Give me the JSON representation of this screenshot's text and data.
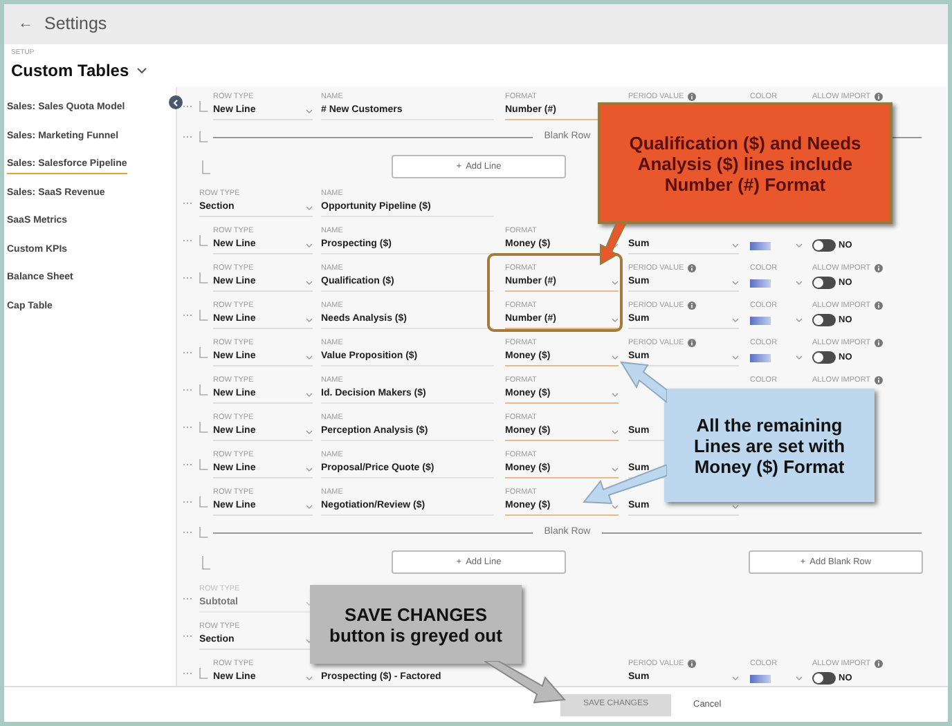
{
  "header": {
    "back": "←",
    "title": "Settings"
  },
  "setup": {
    "label": "SETUP",
    "title": "Custom Tables"
  },
  "sidebar": {
    "items": [
      {
        "label": "Sales: Sales Quota Model",
        "selected": false
      },
      {
        "label": "Sales: Marketing Funnel",
        "selected": false
      },
      {
        "label": "Sales: Salesforce Pipeline",
        "selected": true
      },
      {
        "label": "Sales: SaaS Revenue",
        "selected": false
      },
      {
        "label": "SaaS Metrics",
        "selected": false
      },
      {
        "label": "Custom KPIs",
        "selected": false
      },
      {
        "label": "Balance Sheet",
        "selected": false
      },
      {
        "label": "Cap Table",
        "selected": false
      }
    ]
  },
  "rows": [
    {
      "kind": "line",
      "row_type": {
        "label": "ROW TYPE",
        "value": "New Line"
      },
      "name": {
        "label": "NAME",
        "value": "# New Customers"
      },
      "format": {
        "label": "FORMAT",
        "value": "Number (#)"
      },
      "period_value": {
        "label": "PERIOD VALUE"
      },
      "color": {
        "label": "COLOR"
      },
      "allow_import": {
        "label": "ALLOW IMPORT"
      }
    },
    {
      "kind": "blank",
      "text": "Blank Row"
    },
    {
      "kind": "add",
      "buttons": [
        {
          "label": "Add Line",
          "icon": "+"
        }
      ]
    },
    {
      "kind": "section",
      "row_type": {
        "label": "ROW TYPE",
        "value": "Section"
      },
      "name": {
        "label": "NAME",
        "value": "Opportunity Pipeline ($)"
      }
    },
    {
      "kind": "line",
      "row_type": {
        "label": "ROW TYPE",
        "value": "New Line"
      },
      "name": {
        "label": "NAME",
        "value": "Prospecting ($)"
      },
      "format": {
        "label": "FORMAT",
        "value": "Money ($)"
      },
      "period_value": {
        "value": "Sum"
      },
      "color": {
        "swatch": true
      },
      "allow_import": {
        "on": false,
        "value": "NO"
      }
    },
    {
      "kind": "line",
      "row_type": {
        "label": "ROW TYPE",
        "value": "New Line"
      },
      "name": {
        "label": "NAME",
        "value": "Qualification ($)"
      },
      "format": {
        "label": "FORMAT",
        "value": "Number (#)"
      },
      "period_value": {
        "label": "PERIOD VALUE",
        "value": "Sum"
      },
      "color": {
        "label": "COLOR",
        "swatch": true
      },
      "allow_import": {
        "label": "ALLOW IMPORT",
        "on": false,
        "value": "NO"
      }
    },
    {
      "kind": "line",
      "row_type": {
        "label": "ROW TYPE",
        "value": "New Line"
      },
      "name": {
        "label": "NAME",
        "value": "Needs Analysis ($)"
      },
      "format": {
        "label": "FORMAT",
        "value": "Number (#)"
      },
      "period_value": {
        "label": "PERIOD VALUE",
        "value": "Sum"
      },
      "color": {
        "label": "COLOR",
        "swatch": true
      },
      "allow_import": {
        "label": "ALLOW IMPORT",
        "on": false,
        "value": "NO"
      }
    },
    {
      "kind": "line",
      "row_type": {
        "label": "ROW TYPE",
        "value": "New Line"
      },
      "name": {
        "label": "NAME",
        "value": "Value Proposition ($)"
      },
      "format": {
        "label": "FORMAT",
        "value": "Money ($)"
      },
      "period_value": {
        "label": "PERIOD VALUE",
        "value": "Sum"
      },
      "color": {
        "label": "COLOR",
        "swatch": true
      },
      "allow_import": {
        "label": "ALLOW IMPORT",
        "on": false,
        "value": "NO"
      }
    },
    {
      "kind": "line",
      "row_type": {
        "label": "ROW TYPE",
        "value": "New Line"
      },
      "name": {
        "label": "NAME",
        "value": "Id. Decision Makers ($)"
      },
      "format": {
        "label": "FORMAT",
        "value": "Money ($)"
      },
      "color": {
        "label": "COLOR"
      },
      "allow_import": {
        "label": "ALLOW IMPORT"
      }
    },
    {
      "kind": "line",
      "row_type": {
        "label": "ROW TYPE",
        "value": "New Line"
      },
      "name": {
        "label": "NAME",
        "value": "Perception Analysis ($)"
      },
      "format": {
        "label": "FORMAT",
        "value": "Money ($)"
      },
      "period_value": {
        "value": "Sum"
      }
    },
    {
      "kind": "line",
      "row_type": {
        "label": "ROW TYPE",
        "value": "New Line"
      },
      "name": {
        "label": "NAME",
        "value": "Proposal/Price Quote ($)"
      },
      "format": {
        "label": "FORMAT",
        "value": "Money ($)"
      },
      "period_value": {
        "value": "Sum"
      }
    },
    {
      "kind": "line",
      "row_type": {
        "label": "ROW TYPE",
        "value": "New Line"
      },
      "name": {
        "label": "NAME",
        "value": "Negotiation/Review ($)"
      },
      "format": {
        "label": "FORMAT",
        "value": "Money ($)"
      },
      "period_value": {
        "value": "Sum"
      }
    },
    {
      "kind": "blank",
      "text": "Blank Row"
    },
    {
      "kind": "add",
      "buttons": [
        {
          "label": "Add Line",
          "icon": "+"
        },
        {
          "label": "Add Blank Row",
          "icon": "+"
        }
      ]
    },
    {
      "kind": "subtotal",
      "disabled": true,
      "row_type": {
        "label": "ROW TYPE",
        "value": "Subtotal"
      }
    },
    {
      "kind": "section",
      "disabled": false,
      "row_type": {
        "label": "ROW TYPE",
        "value": "Section"
      }
    },
    {
      "kind": "line",
      "row_type": {
        "label": "ROW TYPE",
        "value": "New Line"
      },
      "name": {
        "value": "Prospecting ($) - Factored"
      },
      "period_value": {
        "label": "PERIOD VALUE",
        "value": "Sum"
      },
      "color": {
        "label": "COLOR",
        "swatch": true
      },
      "allow_import": {
        "label": "ALLOW IMPORT",
        "on": false,
        "value": "NO"
      }
    }
  ],
  "footer": {
    "save": {
      "label": "SAVE CHANGES",
      "disabled": true
    },
    "cancel": "Cancel"
  },
  "callouts": [
    {
      "text": "Qualification ($) and Needs Analysis ($) lines include Number (#) Format",
      "color": "#e8582c"
    },
    {
      "text": "All the remaining Lines are set with Money ($) Format",
      "color": "#bdd7ee"
    },
    {
      "text": "SAVE CHANGES button is greyed out",
      "color": "#b9b9b9"
    }
  ]
}
